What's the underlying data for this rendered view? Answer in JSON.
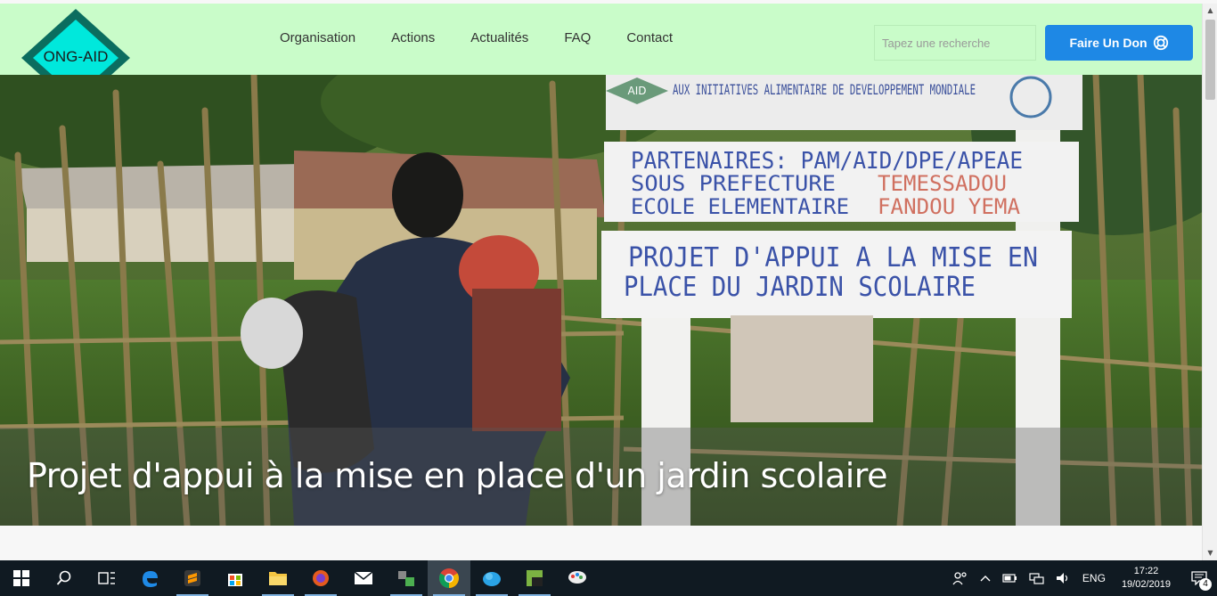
{
  "logo": {
    "text": "ONG-AID"
  },
  "nav": {
    "items": [
      {
        "label": "Organisation"
      },
      {
        "label": "Actions"
      },
      {
        "label": "Actualités"
      },
      {
        "label": "FAQ"
      },
      {
        "label": "Contact"
      }
    ]
  },
  "search": {
    "placeholder": "Tapez une recherche"
  },
  "donate": {
    "label": "Faire Un Don"
  },
  "hero": {
    "caption": "Projet d'appui à la mise en place d'un jardin scolaire",
    "sign_top": "AUX INITIATIVES ALIMENTAIRE DE DEVELOPPEMENT MONDIALE",
    "sign_top_badge": "AID",
    "sign_mid_line1": "PARTENAIRES: PAM/AID/DPE/APEAE",
    "sign_mid_line2_left": "SOUS PREFECTURE",
    "sign_mid_line2_right": "TEMESSADOU",
    "sign_mid_line3_left": "ECOLE ELEMENTAIRE",
    "sign_mid_line3_right": "FANDOU YEMA",
    "sign_bottom_line1": "PROJET D'APPUI A LA MISE EN",
    "sign_bottom_line2": "PLACE DU JARDIN SCOLAIRE"
  },
  "taskbar": {
    "apps": [
      "start",
      "search",
      "task-view",
      "edge",
      "sublime",
      "store",
      "file-explorer",
      "firefox",
      "mail",
      "network-app",
      "chrome",
      "cloud-app",
      "terminal-app",
      "paint-app"
    ],
    "active_app": "chrome",
    "lang": "ENG",
    "time": "17:22",
    "date": "19/02/2019",
    "notification_count": "4"
  },
  "colors": {
    "navbar_bg": "#c9fcc9",
    "donate_bg": "#1e88e5",
    "logo_fill": "#00e0d8",
    "taskbar_bg": "#101a22"
  }
}
